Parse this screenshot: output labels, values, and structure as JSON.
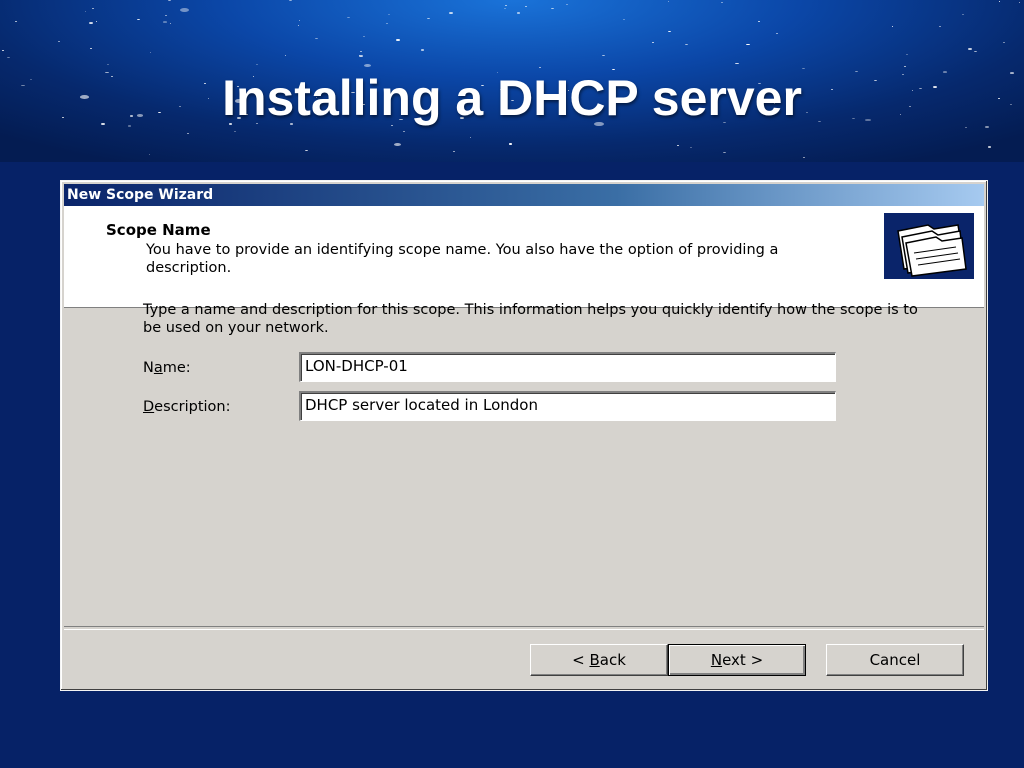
{
  "slide": {
    "title": "Installing a DHCP server"
  },
  "wizard": {
    "window_title": "New Scope Wizard",
    "header": {
      "title": "Scope Name",
      "subtitle": "You have to provide an identifying scope name. You also have the option of providing a description.",
      "icon": "folders-icon"
    },
    "intro_text": "Type a name and description for this scope. This information helps you quickly identify how the scope is to be used on your network.",
    "name_field": {
      "label_pre": "N",
      "label_accel": "a",
      "label_post": "me:",
      "value": "LON-DHCP-01"
    },
    "description_field": {
      "label_pre": "",
      "label_accel": "D",
      "label_post": "escription:",
      "value": "DHCP server located in London"
    },
    "buttons": {
      "back": {
        "pre": "< ",
        "accel": "B",
        "post": "ack"
      },
      "next": {
        "pre": "",
        "accel": "N",
        "post": "ext >"
      },
      "cancel": {
        "label": "Cancel"
      }
    }
  },
  "colors": {
    "slide_background": "#062267",
    "dialog_face": "#d6d3ce",
    "titlebar_start": "#0a246a",
    "titlebar_end": "#a6caf0"
  }
}
